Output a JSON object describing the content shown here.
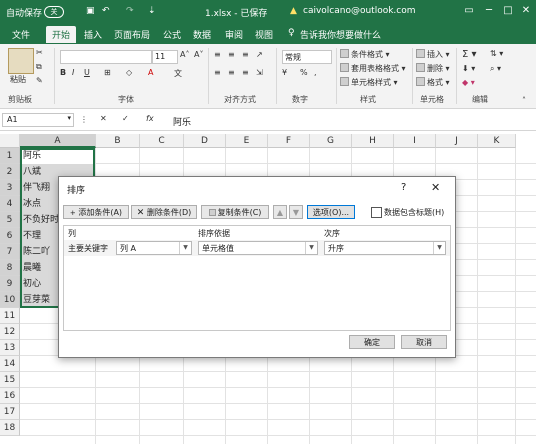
{
  "titlebar": {
    "autosave": "自动保存",
    "autosave_state": "关",
    "filename": "1.xlsx - 已保存",
    "account": "caivolcano@outlook.com"
  },
  "tabs": [
    "文件",
    "开始",
    "插入",
    "页面布局",
    "公式",
    "数据",
    "审阅",
    "视图"
  ],
  "tell_me": "告诉我你想要做什么",
  "ribbon": {
    "paste": "粘贴",
    "font_size": "11",
    "number_format": "常规",
    "conditional_format": "条件格式",
    "table_format": "套用表格格式",
    "cell_style": "单元格样式",
    "insert": "插入",
    "delete": "删除",
    "format": "格式",
    "groups": [
      "剪贴板",
      "字体",
      "对齐方式",
      "数字",
      "样式",
      "单元格",
      "编辑"
    ]
  },
  "formula_bar": {
    "name_box": "A1",
    "fx": "fx",
    "value": "阿乐"
  },
  "columns": [
    "A",
    "B",
    "C",
    "D",
    "E",
    "F",
    "G",
    "H",
    "I",
    "J",
    "K"
  ],
  "rows": [
    "1",
    "2",
    "3",
    "4",
    "5",
    "6",
    "7",
    "8",
    "9",
    "10",
    "11",
    "12",
    "13",
    "14",
    "15",
    "16",
    "17",
    "18"
  ],
  "cells_a": [
    "阿乐",
    "八斌",
    "伴飞翔",
    "冰点",
    "不负好时",
    "不理",
    "陈二吖",
    "晨曦",
    "初心",
    "豆芽菜"
  ],
  "dialog": {
    "title": "排序",
    "help": "?",
    "close": "✕",
    "add_level": "添加条件(A)",
    "delete_level": "删除条件(D)",
    "copy_level": "复制条件(C)",
    "options": "选项(O)...",
    "header_checkbox": "数据包含标题(H)",
    "header_checked": false,
    "col_header": "列",
    "sorton_header": "排序依据",
    "order_header": "次序",
    "row_label": "主要关键字",
    "column_value": "列 A",
    "sorton_value": "单元格值",
    "order_value": "升序",
    "ok": "确定",
    "cancel": "取消"
  },
  "colors": {
    "excel_green": "#217346",
    "selection": "#d9d9d9",
    "selection_border": "#217346"
  }
}
